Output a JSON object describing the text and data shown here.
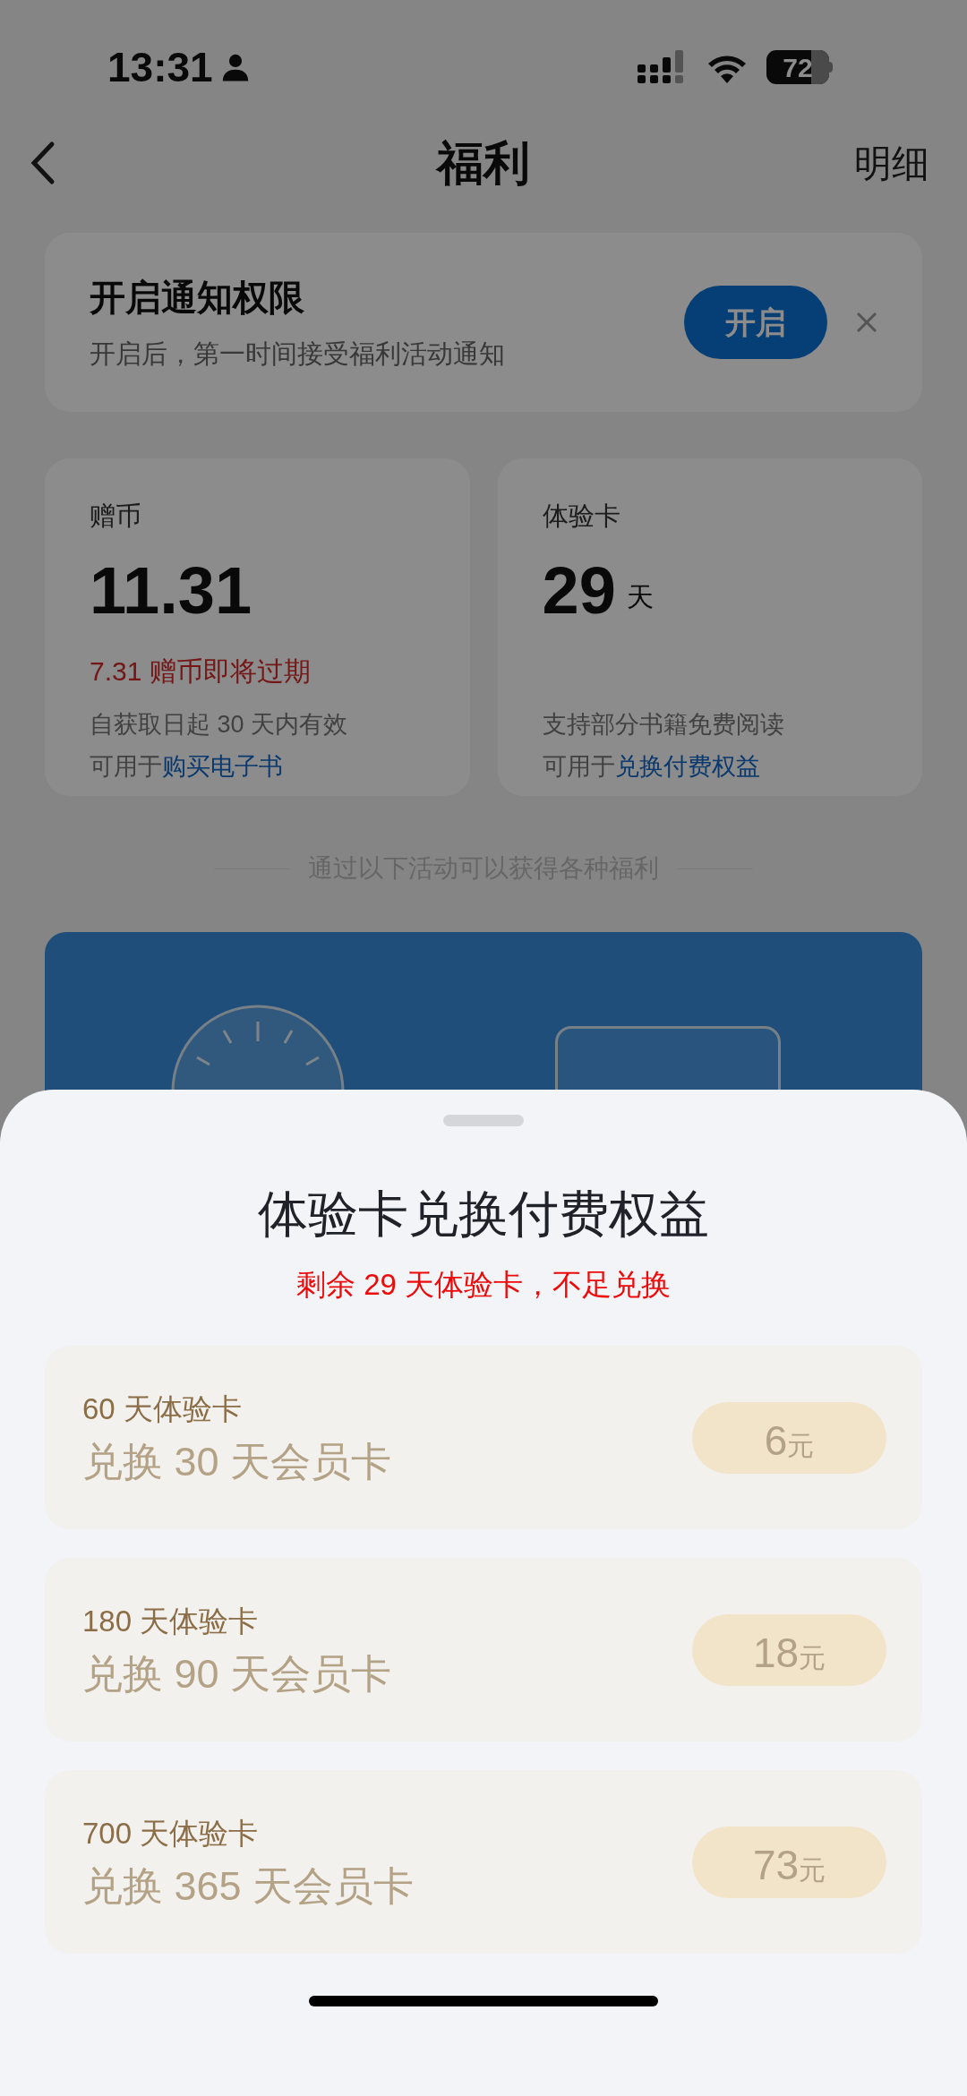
{
  "status_bar": {
    "time": "13:31",
    "battery": "72"
  },
  "nav": {
    "title": "福利",
    "action": "明细"
  },
  "notification": {
    "title": "开启通知权限",
    "subtitle": "开启后，第一时间接受福利活动通知",
    "button": "开启"
  },
  "cards": [
    {
      "label": "赠币",
      "value": "11.31",
      "warning": "7.31 赠币即将过期",
      "note": "自获取日起 30 天内有效",
      "usage_prefix": "可用于",
      "usage_link": "购买电子书"
    },
    {
      "label": "体验卡",
      "value": "29",
      "unit": "天",
      "note": "支持部分书籍免费阅读",
      "usage_prefix": "可用于",
      "usage_link": "兑换付费权益"
    }
  ],
  "divider_text": "通过以下活动可以获得各种福利",
  "sheet": {
    "title": "体验卡兑换付费权益",
    "notice": "剩余 29 天体验卡，不足兑换",
    "options": [
      {
        "card": "60 天体验卡",
        "reward": "兑换 30 天会员卡",
        "price": "6",
        "currency": "元"
      },
      {
        "card": "180 天体验卡",
        "reward": "兑换 90 天会员卡",
        "price": "18",
        "currency": "元"
      },
      {
        "card": "700 天体验卡",
        "reward": "兑换 365 天会员卡",
        "price": "73",
        "currency": "元"
      }
    ]
  }
}
